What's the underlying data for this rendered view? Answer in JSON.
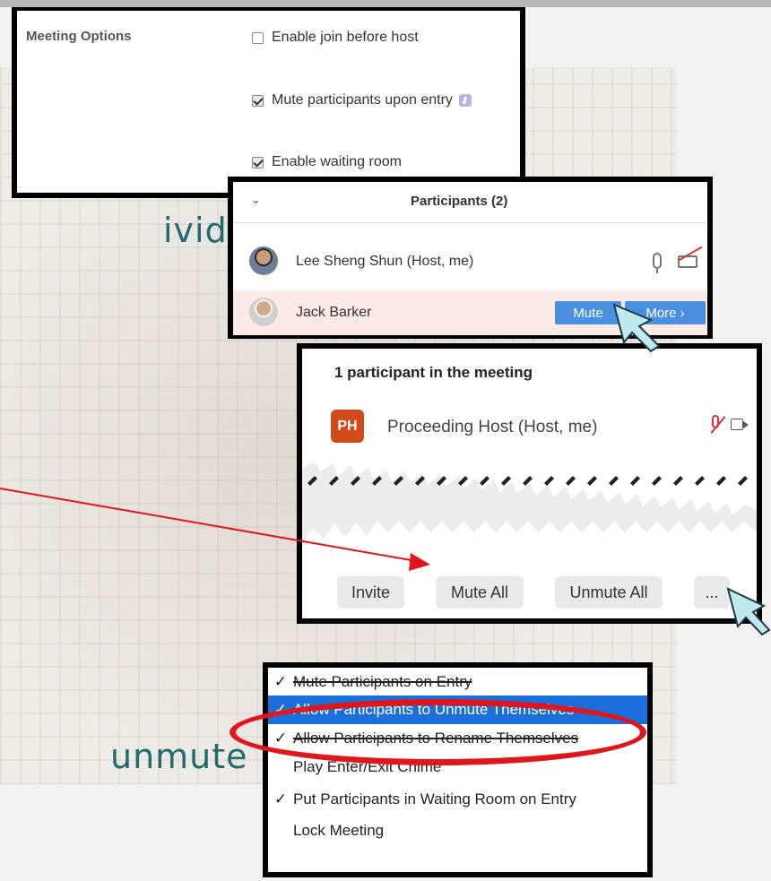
{
  "background_text": {
    "line1": "ividually",
    "line2": "unmute"
  },
  "meeting_options": {
    "label": "Meeting Options",
    "options": [
      {
        "text": "Enable join before host",
        "checked": false
      },
      {
        "text": "Mute participants upon entry",
        "checked": true
      },
      {
        "text": "Enable waiting room",
        "checked": true
      }
    ]
  },
  "participants_panel": {
    "title": "Participants (2)",
    "rows": [
      {
        "name": "Lee Sheng Shun (Host, me)"
      },
      {
        "name": "Jack Barker"
      }
    ],
    "mute_button": "Mute",
    "more_button": "More ›"
  },
  "meeting_panel": {
    "title": "1 participant in the meeting",
    "host_initials": "PH",
    "host_name": "Proceeding Host (Host, me)",
    "buttons": {
      "invite": "Invite",
      "mute_all": "Mute All",
      "unmute_all": "Unmute All",
      "more": "..."
    }
  },
  "more_menu": {
    "items": [
      {
        "text": "Mute Participants on Entry",
        "checked": true
      },
      {
        "text": "Allow Participants to Unmute Themselves",
        "checked": true
      },
      {
        "text": "Allow Participants to Rename Themselves",
        "checked": true
      },
      {
        "text": "Play Enter/Exit Chime",
        "checked": false
      },
      {
        "text": "Put Participants in Waiting Room on Entry",
        "checked": true
      },
      {
        "text": "Lock Meeting",
        "checked": false
      }
    ],
    "check_glyph": "✓"
  },
  "colors": {
    "accent_blue": "#4a8fe0",
    "highlight_blue": "#1a6fdb",
    "annotation_red": "#e0161b",
    "host_avatar": "#d24b1b",
    "title_teal": "#1f6b6e",
    "cursor_fill": "#bfe9ee"
  }
}
